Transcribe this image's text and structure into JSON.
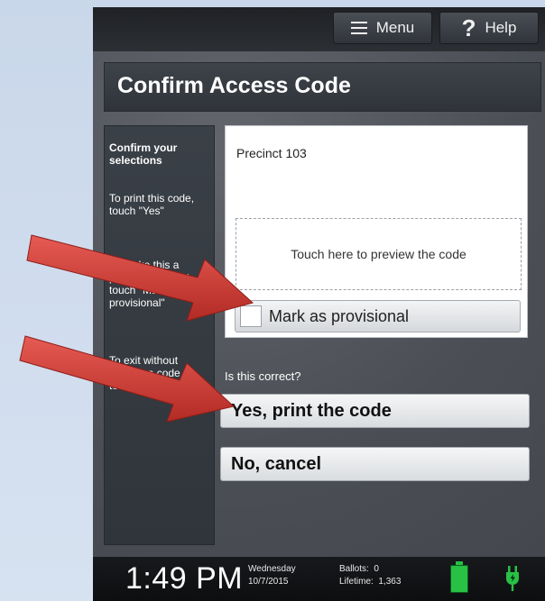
{
  "topbar": {
    "menu_label": "Menu",
    "help_label": "Help",
    "menu_icon": "hamburger-icon",
    "help_icon": "question-icon"
  },
  "title": "Confirm Access Code",
  "sidebar": {
    "heading": "Confirm your selections",
    "line1": "To print this code, touch \"Yes\"",
    "line2": "To make this a provisional ballot, touch \"Mark as provisional\"",
    "line3": "To exit without printing a code, touch \"No\""
  },
  "card": {
    "precinct": "Precinct 103",
    "preview_label": "Touch here to preview the code",
    "provisional_label": "Mark as provisional"
  },
  "question": "Is this correct?",
  "buttons": {
    "yes": "Yes, print the code",
    "no": "No, cancel"
  },
  "status": {
    "time": "1:49 PM",
    "day": "Wednesday",
    "date": "10/7/2015",
    "ballots_label": "Ballots:",
    "ballots_value": "0",
    "lifetime_label": "Lifetime:",
    "lifetime_value": "1,363",
    "battery_icon": "battery-full-icon",
    "power_icon": "plug-icon"
  },
  "colors": {
    "arrow_red": "#c63a33",
    "battery_green": "#28c145"
  }
}
